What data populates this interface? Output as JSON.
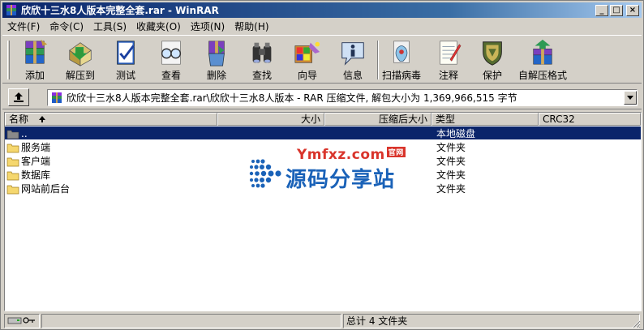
{
  "window": {
    "title": "欣欣十三水8人版本完整全套.rar - WinRAR",
    "minimize_glyph": "_",
    "maximize_glyph": "□",
    "close_glyph": "×"
  },
  "menu": [
    {
      "label": "文件(F)"
    },
    {
      "label": "命令(C)"
    },
    {
      "label": "工具(S)"
    },
    {
      "label": "收藏夹(O)"
    },
    {
      "label": "选项(N)"
    },
    {
      "label": "帮助(H)"
    }
  ],
  "toolbar": [
    {
      "label": "添加",
      "icon": "add-archive-icon"
    },
    {
      "label": "解压到",
      "icon": "extract-to-icon"
    },
    {
      "label": "测试",
      "icon": "test-icon"
    },
    {
      "label": "查看",
      "icon": "view-icon"
    },
    {
      "label": "删除",
      "icon": "delete-icon"
    },
    {
      "label": "查找",
      "icon": "find-icon"
    },
    {
      "label": "向导",
      "icon": "wizard-icon"
    },
    {
      "label": "信息",
      "icon": "info-icon"
    },
    {
      "label": "扫描病毒",
      "icon": "virus-scan-icon"
    },
    {
      "label": "注释",
      "icon": "comment-icon"
    },
    {
      "label": "保护",
      "icon": "protect-icon"
    },
    {
      "label": "自解压格式",
      "icon": "sfx-icon"
    }
  ],
  "address": {
    "path": "欣欣十三水8人版本完整全套.rar\\欣欣十三水8人版本 - RAR 压缩文件, 解包大小为 1,369,966,515 字节"
  },
  "columns": {
    "name": "名称",
    "size": "大小",
    "packed": "压缩后大小",
    "type": "类型",
    "crc": "CRC32"
  },
  "rows": [
    {
      "name": "..",
      "type": "本地磁盘",
      "selected": true
    },
    {
      "name": "服务端",
      "type": "文件夹"
    },
    {
      "name": "客户端",
      "type": "文件夹"
    },
    {
      "name": "数据库",
      "type": "文件夹"
    },
    {
      "name": "网站前后台",
      "type": "文件夹"
    }
  ],
  "watermark": {
    "top": "Ymfxz.com",
    "badge": "官网",
    "bottom": "源码分享站"
  },
  "status": {
    "summary": "总计 4 文件夹"
  },
  "colors": {
    "title_start": "#0a246a",
    "selection": "#0a246a",
    "face": "#d4d0c8"
  }
}
